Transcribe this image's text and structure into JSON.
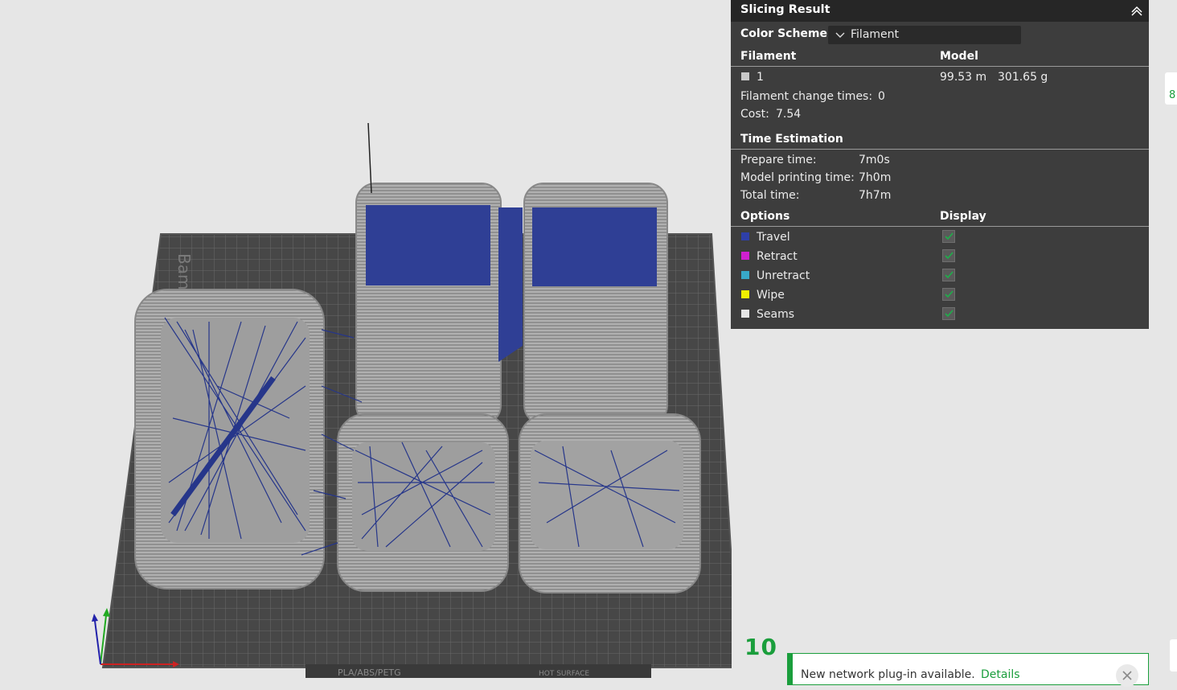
{
  "viewport": {
    "bed_brand_text": "Bambu",
    "bed_plate_label": "PLA/ABS/PETG",
    "bed_surface_label": "HOT SURFACE",
    "layer_number": "10",
    "colors": {
      "background": "#e6e6e6",
      "bed": "#444444",
      "model": "#a8a8a8",
      "travel": "#2a3a8c"
    }
  },
  "panel": {
    "title": "Slicing Result",
    "color_scheme_label": "Color Scheme",
    "color_scheme_value": "Filament",
    "filament_header": "Filament",
    "model_header": "Model",
    "filament_row": {
      "id": "1",
      "length": "99.53 m",
      "weight": "301.65 g",
      "color": "#c8c8c8"
    },
    "filament_change_label": "Filament change times:",
    "filament_change_value": "0",
    "cost_label": "Cost:",
    "cost_value": "7.54",
    "time_header": "Time Estimation",
    "prepare_label": "Prepare time:",
    "prepare_value": "7m0s",
    "model_print_label": "Model printing time:",
    "model_print_value": "7h0m",
    "total_label": "Total time:",
    "total_value": "7h7m",
    "options_header": "Options",
    "display_header": "Display",
    "options": [
      {
        "label": "Travel",
        "color": "#2e3fa8",
        "checked": true
      },
      {
        "label": "Retract",
        "color": "#d020d0",
        "checked": true
      },
      {
        "label": "Unretract",
        "color": "#38a8c8",
        "checked": true
      },
      {
        "label": "Wipe",
        "color": "#f0f000",
        "checked": true
      },
      {
        "label": "Seams",
        "color": "#e6e6e6",
        "checked": true
      }
    ]
  },
  "edge_tab_text": "8",
  "notification": {
    "message": "New network plug-in available.",
    "link": "Details"
  }
}
